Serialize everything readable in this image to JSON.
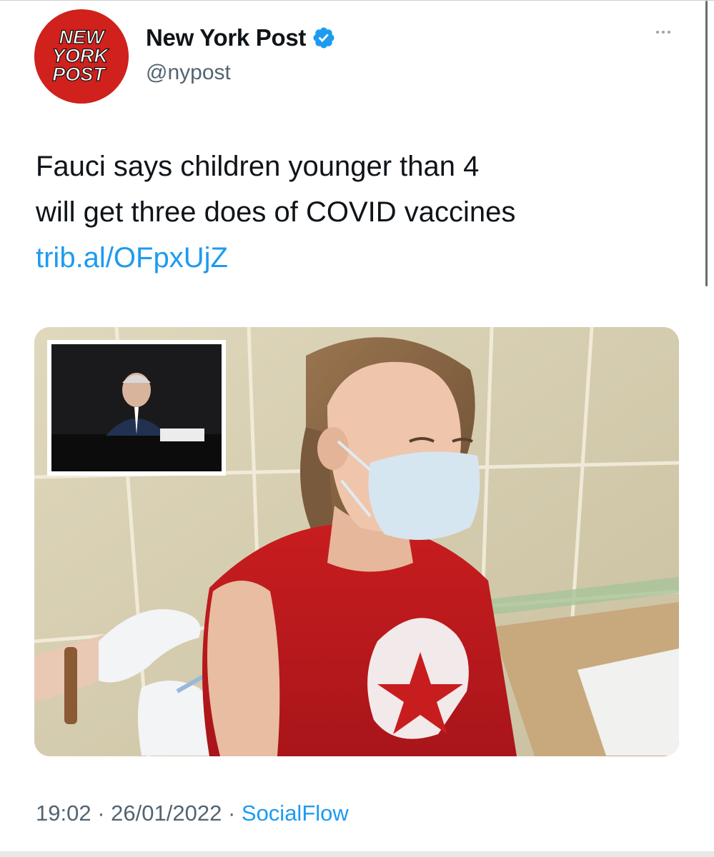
{
  "account": {
    "display_name": "New York Post",
    "handle": "@nypost",
    "avatar_logo_text": [
      "NEW",
      "YORK",
      "POST"
    ]
  },
  "tweet": {
    "text_lines": [
      "Fauci says children younger than 4",
      "will get three does of COVID vaccines"
    ],
    "link": "trib.al/OFpxUjZ"
  },
  "meta": {
    "time": "19:02",
    "separator": "·",
    "date": "26/01/2022",
    "source": "SocialFlow"
  },
  "icons": {
    "verified": "verified-badge-icon",
    "more": "more-options-icon"
  },
  "colors": {
    "brand_red": "#d0211c",
    "link_blue": "#1d9bf0",
    "verified_blue": "#1d9bf0",
    "secondary_text": "#536471"
  }
}
